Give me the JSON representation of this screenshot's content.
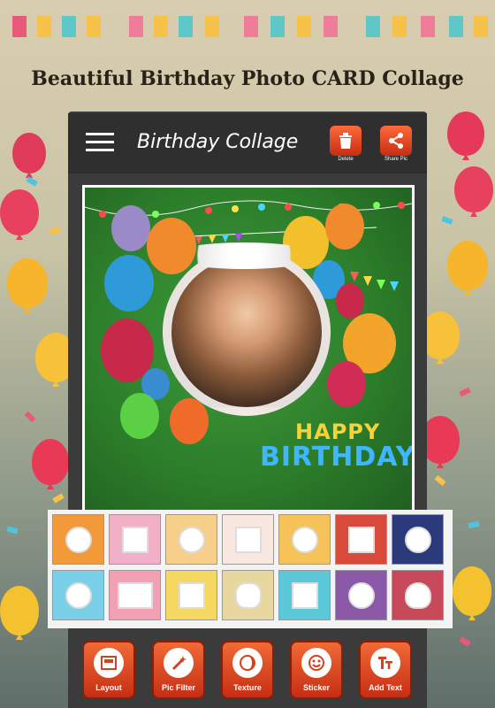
{
  "headline": "Beautiful Birthday Photo CARD Collage",
  "appbar": {
    "title": "Birthday Collage",
    "delete_label": "Delete",
    "share_label": "Share Pic"
  },
  "card": {
    "happy": "HAPPY",
    "birthday": "BIRTHDAY"
  },
  "toolbar": {
    "layout": "Layout",
    "pic_filter": "Pic Filter",
    "texture": "Texture",
    "sticker": "Sticker",
    "add_text": "Add Text"
  },
  "colors": {
    "accent": "#d8401c",
    "appbar": "#2f2f2f",
    "card_green": "#2d7f2b"
  },
  "icons": {
    "menu": "hamburger-menu-icon",
    "delete": "trash-icon",
    "share": "share-icon",
    "layout": "layout-icon",
    "pic_filter": "magic-wand-icon",
    "texture": "texture-icon",
    "sticker": "smiley-icon",
    "add_text": "text-tt-icon"
  }
}
